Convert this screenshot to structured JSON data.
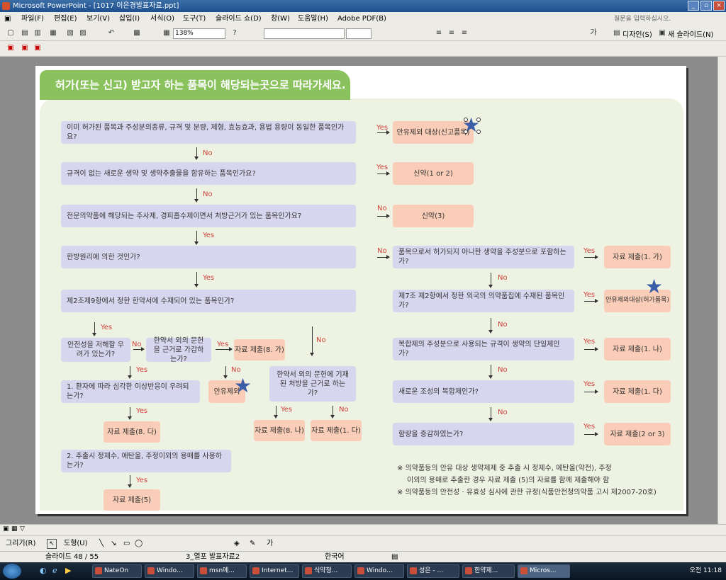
{
  "window": {
    "title": "Microsoft PowerPoint - [1017 이은경발표자료.ppt]"
  },
  "menu": {
    "items": [
      "파일(F)",
      "편집(E)",
      "보기(V)",
      "삽입(I)",
      "서식(O)",
      "도구(T)",
      "슬라이드 쇼(D)",
      "창(W)",
      "도움말(H)",
      "Adobe PDF(B)"
    ],
    "help_placeholder": "질문을 입력하십시오."
  },
  "toolbar": {
    "zoom": "138%",
    "design_label": "디자인(S)",
    "new_slide_label": "새 슬라이드(N)"
  },
  "slide": {
    "header": "허가(또는 신고) 받고자 하는 품목이 해당되는곳으로 따라가세요.",
    "questions": {
      "q1": "이미 허가된 품목과 주성분의종류, 규격 및 분량, 제형, 효능효과, 용법 용량이 동일한 품목인가요?",
      "q2": "규격이 없는 새로운 생약 및 생약추출물을 함유하는 품목인가요?",
      "q3": "전문의약품에 해당되는 주사제, 경피흡수제이면서 처방근거가 있는 품목인가요?",
      "q4": "한방원리에 의한 것인가?",
      "q5": "제2조제9항에서 정한 한약서에 수재되어 있는 품목인가?",
      "q6": "안전성을 저해할 우려가 있는가?",
      "q7": "한약서 외의 문헌을 근거로 가감하는가?",
      "q8": "1. 환자에 따라 심각한 이상반응이 우려되는가?",
      "q9": "한약서 외의 문헌에 기재된 처방을 근거로 하는가?",
      "q10": "2. 추출시 정제수, 에탄올, 주정이외의 용매를 사용하는가?",
      "r1": "품목으로서 허가되지 아니한 생약을 주성분으로 포함하는가?",
      "r2": "제7조 제2항에서 정한 외국의 의약품집에 수재된 품목인가?",
      "r3": "복합제의 주성분으로 사용되는 규격이 생약의 단일제인가?",
      "r4": "새로운 조성의 복합제인가?",
      "r5": "함량을 증감하였는가?"
    },
    "answers": {
      "a1": "안유제외 대상(신고품목)",
      "a2": "신약(1 or 2)",
      "a3": "신약(3)",
      "a4": "자료 제출(8. 가)",
      "a5": "안유제외",
      "a6": "자료 제출(8. 다)",
      "a7": "자료 제출(8. 나)",
      "a8": "자료 제출(1. 다)",
      "a9": "자료 제출(5)",
      "ra1": "자료 제출(1. 가)",
      "ra2": "안유제외대상(허가품목)",
      "ra3": "자료 제출(1. 나)",
      "ra4": "자료 제출(1. 다)",
      "ra5": "자료 제출(2 or 3)"
    },
    "labels": {
      "yes": "Yes",
      "no": "No"
    },
    "notes": [
      "※ 의약품등의 안유 대상 생약제제 중 추출 시 정제수, 에탄올(약전), 주정",
      "이외의 용매로 추출한 경우 자료 제출 (5)의 자료를 함께 제출해야 함",
      "※ 의약품등의 안전성 · 유효성 심사에 관한 규정(식품안전청의약품 고시 제2007-20호)"
    ]
  },
  "drawing": {
    "draw_label": "그리기(R)",
    "shapes_label": "도형(U)"
  },
  "status": {
    "slide": "슬라이드 48 / 55",
    "design": "3_열포 발표자료2",
    "language": "한국어"
  },
  "taskbar": {
    "tasks": [
      "NateOn",
      "Windo...",
      "msn메...",
      "Internet...",
      "식약청...",
      "Windo...",
      "성은 - ...",
      "한약제...",
      "Micros..."
    ],
    "clock": "오전 11:18"
  }
}
